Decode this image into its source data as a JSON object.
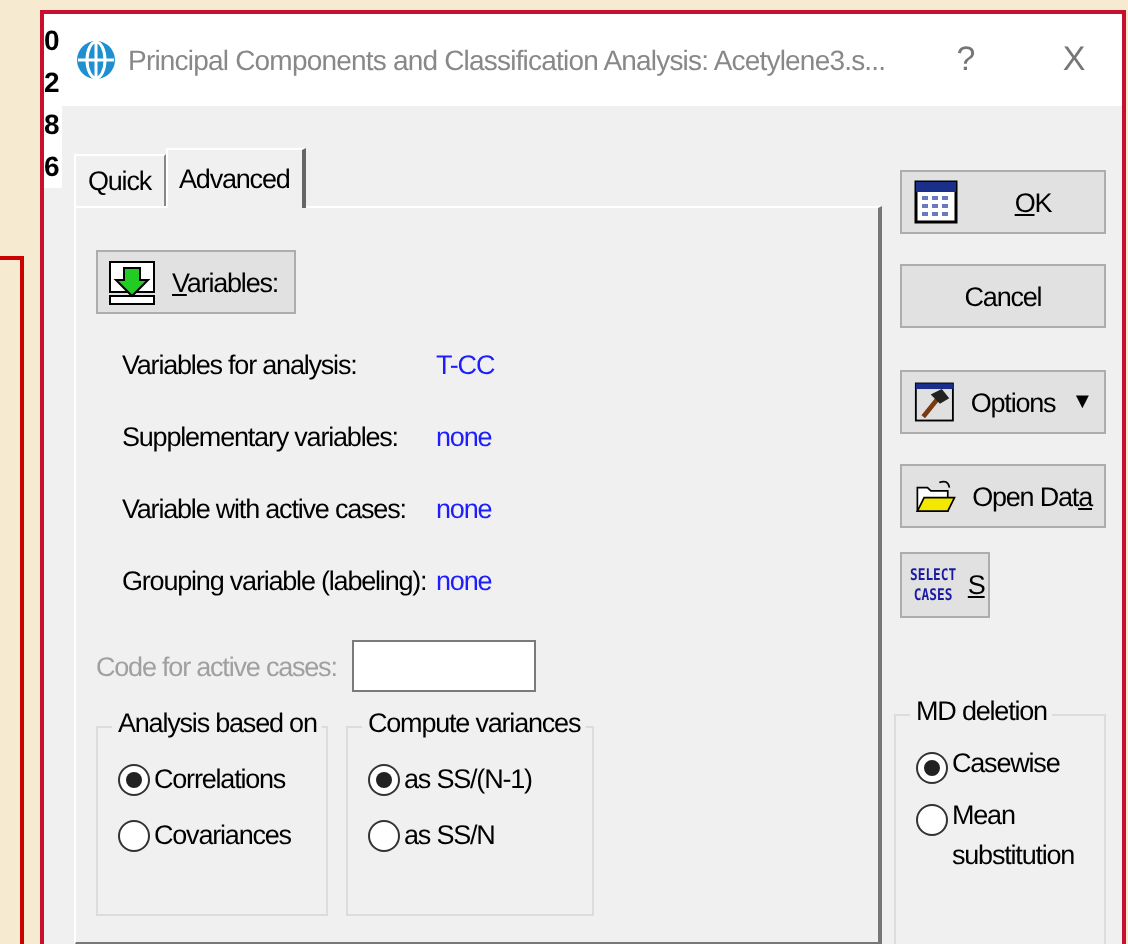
{
  "background_sheet": {
    "cells": [
      "0",
      "2",
      "8",
      "6"
    ]
  },
  "window": {
    "title": "Principal Components and Classification Analysis: Acetylene3.s...",
    "help": "?",
    "close": "X"
  },
  "tabs": [
    {
      "label": "Quick",
      "selected": false
    },
    {
      "label": "Advanced",
      "selected": true
    }
  ],
  "variables_button": {
    "label": [
      {
        "text": "V",
        "underlined": true
      },
      {
        "text": "ariables:",
        "underlined": false
      }
    ]
  },
  "variable_fields": [
    {
      "label": "Variables for analysis:",
      "value": "T-CC"
    },
    {
      "label": "Supplementary variables:",
      "value": "none"
    },
    {
      "label": "Variable with active cases:",
      "value": "none"
    },
    {
      "label": "Grouping variable (labeling):",
      "value": "none"
    }
  ],
  "code_field": {
    "label": "Code for active cases:",
    "disabled": true
  },
  "groups": [
    {
      "title": "Analysis based on",
      "options": [
        {
          "label": "Correlations",
          "selected": true
        },
        {
          "label": "Covariances",
          "selected": false
        }
      ]
    },
    {
      "title": "Compute variances",
      "options": [
        {
          "label": "as SS/(N-1)",
          "selected": true
        },
        {
          "label": "as SS/N",
          "selected": false
        }
      ]
    }
  ],
  "buttons": [
    {
      "kind": "ok",
      "label": [
        {
          "text": "O",
          "underlined": true
        },
        {
          "text": "K",
          "underlined": false
        }
      ]
    },
    {
      "kind": "cancel",
      "label": "Cancel"
    },
    {
      "kind": "options",
      "label": "Options",
      "caret": "▼"
    },
    {
      "kind": "open",
      "label": [
        {
          "text": "Open Dat",
          "underlined": false
        },
        {
          "text": "a",
          "underlined": true
        }
      ]
    },
    {
      "kind": "select",
      "label": [
        {
          "text": "S",
          "underlined": true
        }
      ],
      "badge": [
        "SELECT",
        "CASES"
      ]
    }
  ],
  "md_deletion": {
    "title": "MD deletion",
    "options": [
      {
        "label": "Casewise",
        "selected": true
      },
      {
        "label": "Mean substitution",
        "selected": false
      }
    ]
  }
}
